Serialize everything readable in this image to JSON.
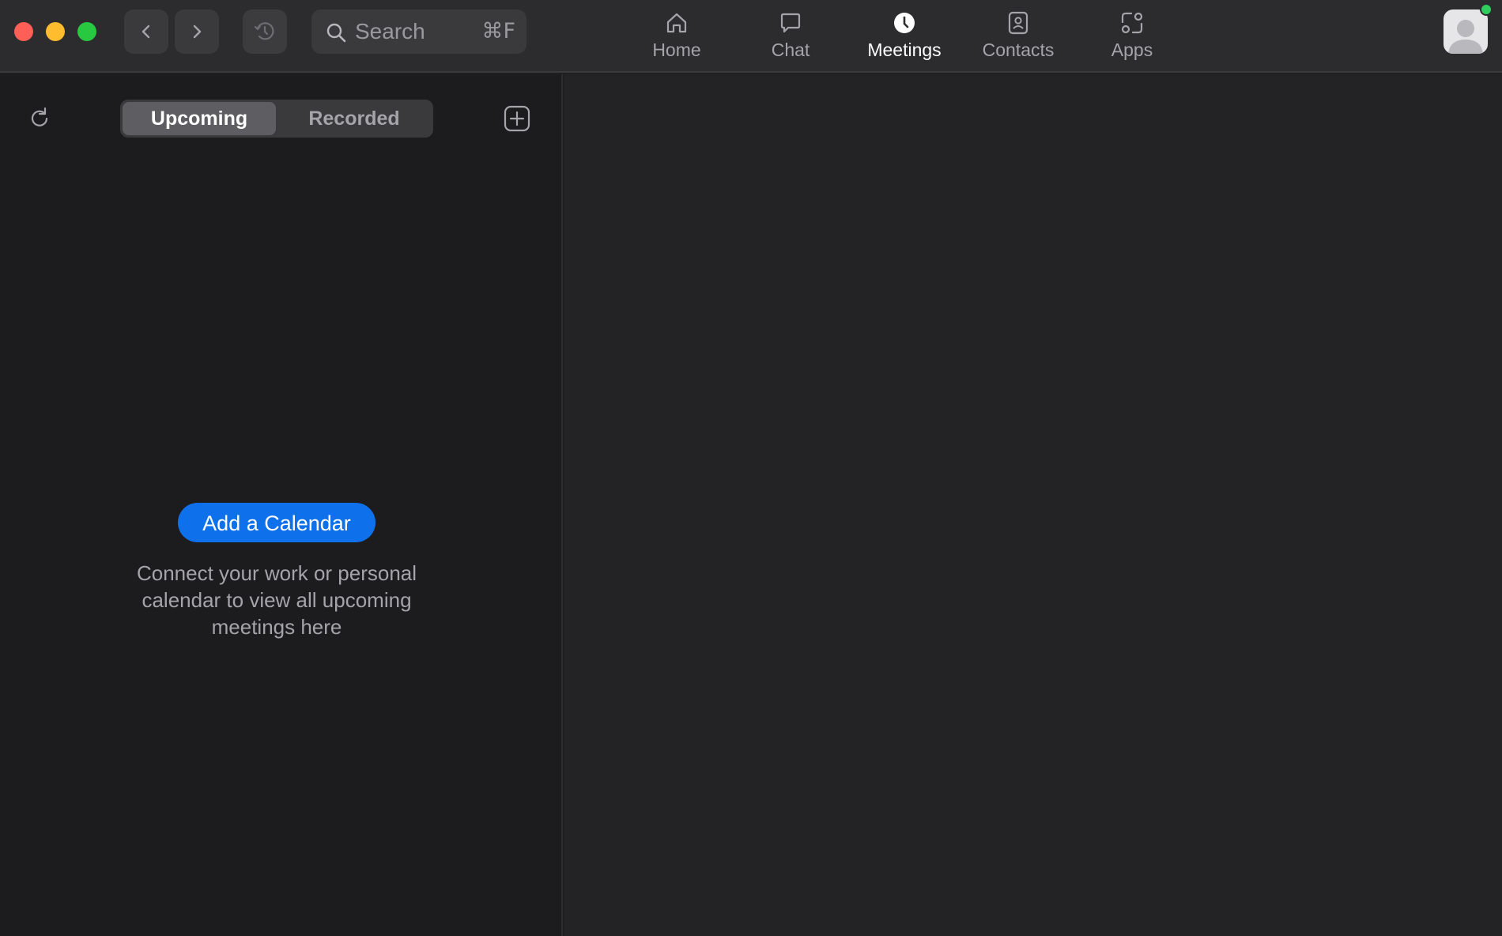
{
  "window": {
    "traffic_lights": {
      "close_color": "#ff5f57",
      "minimize_color": "#febc2e",
      "maximize_color": "#28c840"
    }
  },
  "toolbar": {
    "back_icon": "chevron-left-icon",
    "forward_icon": "chevron-right-icon",
    "history_icon": "history-clock-icon",
    "search": {
      "placeholder": "Search",
      "shortcut": "⌘F",
      "icon": "search-icon"
    }
  },
  "tabs": [
    {
      "label": "Home",
      "icon": "home-icon",
      "active": false
    },
    {
      "label": "Chat",
      "icon": "chat-bubble-icon",
      "active": false
    },
    {
      "label": "Meetings",
      "icon": "clock-icon",
      "active": true
    },
    {
      "label": "Contacts",
      "icon": "contact-card-icon",
      "active": false
    },
    {
      "label": "Apps",
      "icon": "apps-icon",
      "active": false
    }
  ],
  "profile": {
    "avatar_icon": "person-avatar-icon",
    "status_color": "#2fcc5e"
  },
  "meetings_panel": {
    "refresh_icon": "refresh-icon",
    "segments": [
      "Upcoming",
      "Recorded"
    ],
    "selected_segment": "Upcoming",
    "new_meeting_icon": "plus-square-icon",
    "add_calendar_label": "Add a Calendar",
    "helper_lines": [
      "Connect your work or personal",
      "calendar to view all upcoming",
      "meetings here"
    ]
  },
  "colors": {
    "accent": "#0e71eb",
    "topbar_bg": "#2c2c2e",
    "left_panel_bg": "#1c1c1e",
    "right_panel_bg": "#232325"
  }
}
